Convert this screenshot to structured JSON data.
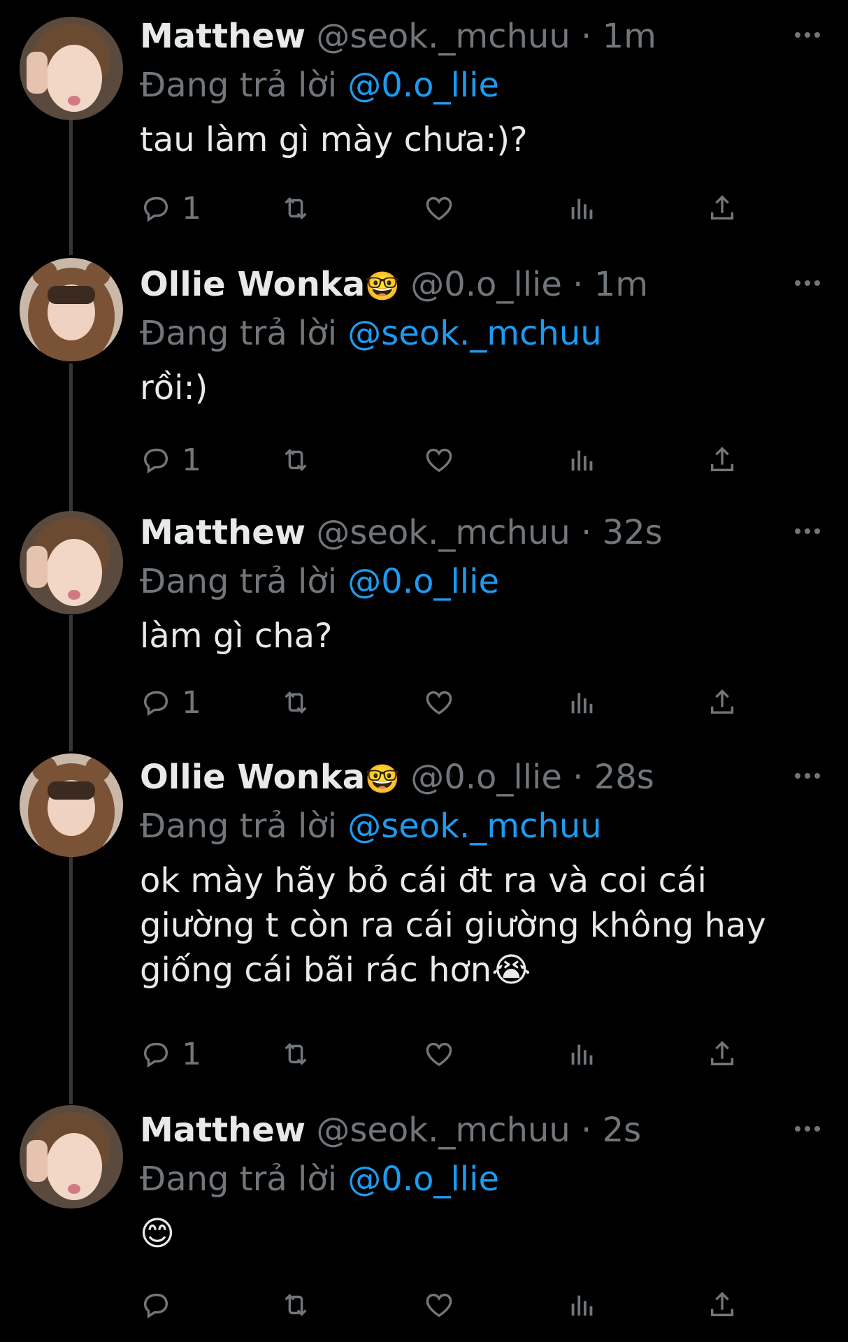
{
  "tweets": [
    {
      "name": "Matthew",
      "badge": "",
      "handle": "@seok._mchuu",
      "dot": "·",
      "time": "1m",
      "reply_prefix": "Đang trả lời",
      "reply_to": "@0.o_llie",
      "text": "tau làm gì mày chưa:)?",
      "reply_count": "1",
      "avatar": "matthew"
    },
    {
      "name": "Ollie Wonka",
      "badge": "🤓",
      "handle": "@0.o_llie",
      "dot": "·",
      "time": "1m",
      "reply_prefix": "Đang trả lời",
      "reply_to": "@seok._mchuu",
      "text": "rồi:)",
      "reply_count": "1",
      "avatar": "ollie"
    },
    {
      "name": "Matthew",
      "badge": "",
      "handle": "@seok._mchuu",
      "dot": "·",
      "time": "32s",
      "reply_prefix": "Đang trả lời",
      "reply_to": "@0.o_llie",
      "text": "làm gì cha?",
      "reply_count": "1",
      "avatar": "matthew"
    },
    {
      "name": "Ollie Wonka",
      "badge": "🤓",
      "handle": "@0.o_llie",
      "dot": "·",
      "time": "28s",
      "reply_prefix": "Đang trả lời",
      "reply_to": "@seok._mchuu",
      "text": "ok mày hãy bỏ cái đt ra và coi cái giường t còn ra cái giường không hay giống cái bãi rác hơn😭",
      "reply_count": "1",
      "avatar": "ollie"
    },
    {
      "name": "Matthew",
      "badge": "",
      "handle": "@seok._mchuu",
      "dot": "·",
      "time": "2s",
      "reply_prefix": "Đang trả lời",
      "reply_to": "@0.o_llie",
      "text": "😊",
      "reply_count": "",
      "avatar": "matthew"
    }
  ],
  "icons": {
    "reply": "reply-icon",
    "retweet": "retweet-icon",
    "like": "heart-icon",
    "views": "views-icon",
    "share": "share-icon",
    "more": "more-icon"
  },
  "colors": {
    "background": "#000000",
    "text": "#e7e9ea",
    "muted": "#71767b",
    "link": "#1d9bf0"
  }
}
